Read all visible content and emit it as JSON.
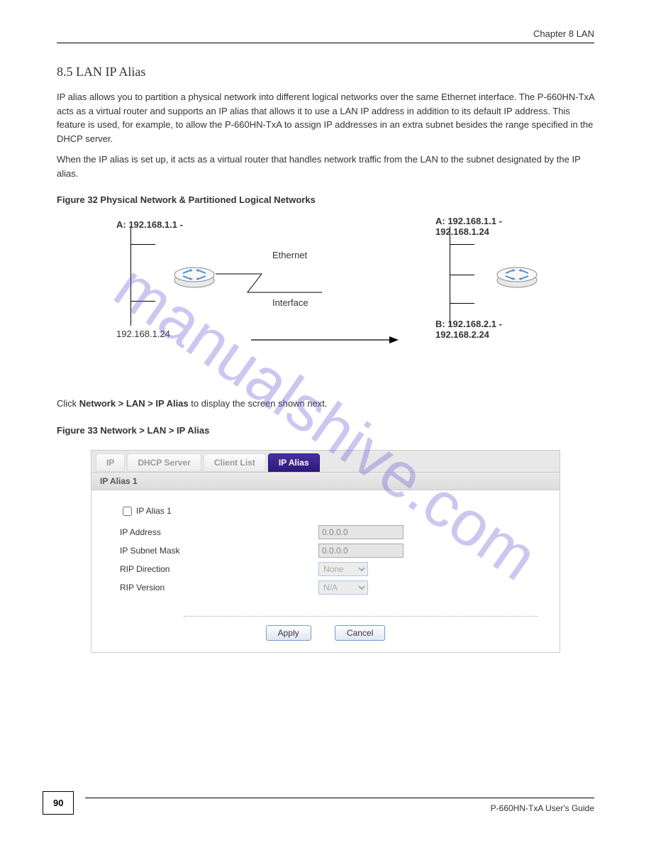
{
  "header": {
    "chapter": "Chapter 8 LAN"
  },
  "section85": {
    "title": "8.5  LAN IP Alias",
    "p1": "IP alias allows you to partition a physical network into different logical networks over the same Ethernet interface. The P-660HN-TxA acts as a virtual router and supports an IP alias that allows it to use a LAN IP address in addition to its default IP address. This feature is used, for example, to allow the P-660HN-TxA to assign IP addresses in an extra subnet besides the range specified in the DHCP server.",
    "p2": "When the IP alias is set up, it acts as a virtual router that handles network traffic from the LAN to the subnet designated by the IP alias."
  },
  "figure32": {
    "title": "Figure 32   Physical Network & Partitioned Logical Networks",
    "left_label_a": "A: 192.168.1.1 -",
    "left_label_b": "192.168.1.24",
    "ethernet_label": "Ethernet\nInterface",
    "right_label_a_1": "A: 192.168.1.1 -",
    "right_label_a_2": "192.168.1.24",
    "right_label_b_1": "B: 192.168.2.1 -",
    "right_label_b_2": "192.168.2.24"
  },
  "nav_text": "Click Network > LAN > IP Alias to display the screen shown next.",
  "figure33": {
    "title": "Figure 33   Network > LAN > IP Alias"
  },
  "tabs": {
    "ip": "IP",
    "dhcp": "DHCP Server",
    "client_list": "Client List",
    "ip_alias": "IP Alias"
  },
  "panel": {
    "section_header": "IP Alias 1",
    "checkbox_label": "IP Alias 1",
    "ip_address_label": "IP Address",
    "ip_address_value": "0.0.0.0",
    "subnet_label": "IP Subnet Mask",
    "subnet_value": "0.0.0.0",
    "rip_dir_label": "RIP Direction",
    "rip_dir_value": "None",
    "rip_ver_label": "RIP Version",
    "rip_ver_value": "N/A",
    "apply": "Apply",
    "cancel": "Cancel"
  },
  "footer": {
    "page_num": "90",
    "guide": "P-660HN-TxA User's Guide"
  }
}
